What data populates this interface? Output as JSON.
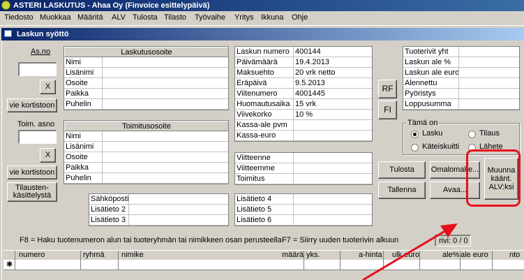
{
  "window_title": "ASTERI LASKUTUS - Ahaa Oy (Finvoice esittelypäivä)",
  "menu": [
    "Tiedosto",
    "Muokkaa",
    "Määritä",
    "ALV",
    "Tulosta",
    "Tilasto",
    "Työvaihe",
    "Yritys",
    "Ikkuna",
    "Ohje"
  ],
  "subwindow_title": "Laskun syöttö",
  "left": {
    "asno_label": "As.no",
    "x_button": "X",
    "vie_kortistoon": "vie kortistoon",
    "toim_asno_label": "Toim. asno",
    "x_button2": "X",
    "vie_kortistoon2": "vie kortistoon",
    "tilaus_button": "Tilausten-\nkäsittelystä"
  },
  "laskutusosoite": {
    "title": "Laskutusosoite",
    "rows": [
      "Nimi",
      "Lisänimi",
      "Osoite",
      "Paikka",
      "Puhelin"
    ]
  },
  "toimitusosoite": {
    "title": "Toimitusosoite",
    "rows": [
      "Nimi",
      "Lisänimi",
      "Osoite",
      "Paikka",
      "Puhelin"
    ]
  },
  "lisatiedot_left": [
    "Sähköposti",
    "Lisätieto 2",
    "Lisätieto 3"
  ],
  "invoice": {
    "rows": [
      {
        "label": "Laskun numero",
        "value": "400144"
      },
      {
        "label": "Päivämäärä",
        "value": "19.4.2013"
      },
      {
        "label": "Maksuehto",
        "value": "20 vrk netto"
      },
      {
        "label": "Eräpäivä",
        "value": "9.5.2013"
      },
      {
        "label": "Viitenumero",
        "value": "4001445"
      },
      {
        "label": "Huomautusaika",
        "value": "15 vrk"
      },
      {
        "label": "Viivekorko",
        "value": "10 %"
      },
      {
        "label": "Kassa-ale pvm",
        "value": ""
      },
      {
        "label": "Kassa-euro",
        "value": ""
      }
    ]
  },
  "references": [
    "Viitteenne",
    "Viitteemme",
    "Toimitus"
  ],
  "lisatiedot_mid": [
    "Lisätieto 4",
    "Lisätieto 5",
    "Lisätieto 6"
  ],
  "rf_button": "RF",
  "fi_button": "FI",
  "totals": [
    "Tuoterivit yht",
    "Laskun ale %",
    "Laskun ale euro",
    "Alennettu",
    "Pyöristys",
    "Loppusumma"
  ],
  "tama_on": {
    "title": "Tämä on",
    "options": [
      {
        "label": "Lasku",
        "selected": true
      },
      {
        "label": "Tilaus",
        "selected": false
      },
      {
        "label": "Käteiskuitti",
        "selected": false
      },
      {
        "label": "Lähete",
        "selected": false
      }
    ]
  },
  "buttons": {
    "tulosta": "Tulosta",
    "omalomake": "Omalomake...",
    "muunna": "Muunna käänt. ALV:ksi",
    "tallenna": "Tallenna",
    "avaa": "Avaa..."
  },
  "hints": {
    "f8": "F8 = Haku tuotenumeron alun tai tuoteryhmän tai nimikkeen osan perusteella",
    "f7": "F7 = Siirry uuden tuoterivin alkuun",
    "rivi": "rivi: 0 / 0"
  },
  "table_columns": [
    "numero",
    "ryhmä",
    "nimike",
    "määrä",
    "yks.",
    "a-hinta",
    "ulk.euro",
    "ale%",
    "ale euro",
    "nto"
  ],
  "new_row_marker": "✱",
  "colors": {
    "title_bar": "#0a246a",
    "annotation_red": "#e8101a",
    "face": "#d4d0c8"
  }
}
